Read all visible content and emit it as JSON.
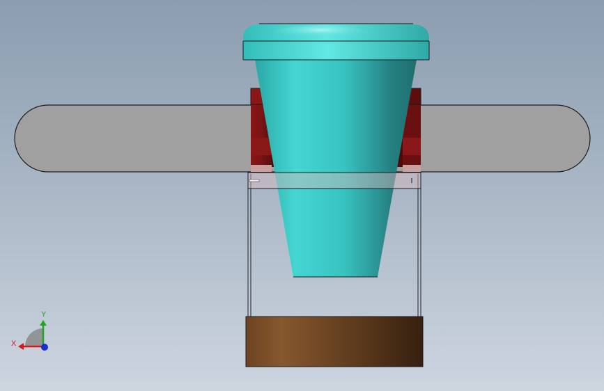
{
  "viewport": {
    "background_top": "#8b9db0",
    "background_bottom": "#cdd5df"
  },
  "model": {
    "parts": [
      {
        "id": "cone-funnel",
        "color": "#35c4c0"
      },
      {
        "id": "slot-bar",
        "color": "#a0a0a0"
      },
      {
        "id": "red-clamp",
        "color": "#8b1a1a"
      },
      {
        "id": "wooden-base",
        "color": "#7a5029"
      }
    ]
  },
  "triad": {
    "x_label": "X",
    "y_label": "Y",
    "x_color": "#d21a1a",
    "y_color": "#1fa51f",
    "z_color": "#1a2fd2"
  }
}
